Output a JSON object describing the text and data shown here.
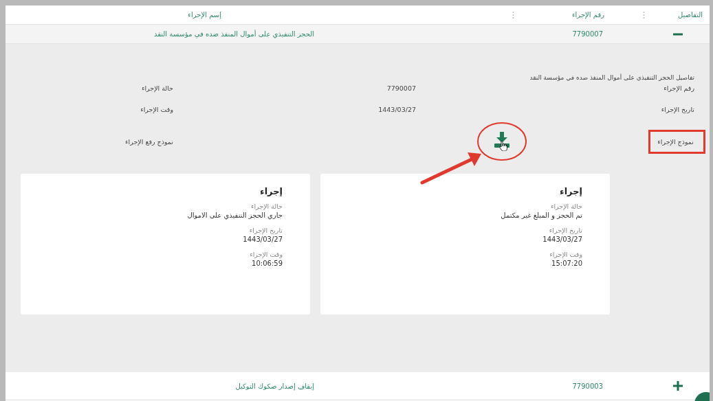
{
  "columns": [
    {
      "label": "التفاصيل"
    },
    {
      "label": "رقم الإجراء"
    },
    {
      "label": "إسم الإجراء"
    }
  ],
  "rows": [
    {
      "expanded": true,
      "number": "7790007",
      "name": "الحجز التنفيذي على أموال المنفذ ضده في مؤسسة النقد",
      "details": {
        "title": "تفاصيل الحجز التنفيذي على أموال المنفذ ضده في مؤسسة النقد",
        "rows": [
          {
            "kind": "text",
            "label": "رقم الإجراء",
            "value": "7790007",
            "side_label": "حالة الإجراء",
            "highlighted": false
          },
          {
            "kind": "text",
            "label": "تاريخ الإجراء",
            "value": "1443/03/27",
            "side_label": "وقت الإجراء",
            "highlighted": false
          },
          {
            "kind": "download",
            "label": "نموذج الإجراء",
            "side_label": "نموذج رفع الإجراء",
            "highlighted": true
          }
        ],
        "cards": [
          {
            "title": "إجراء",
            "fields": [
              {
                "label": "حالة الإجراء",
                "value": "تم الحجز و المبلغ غير مكتمل"
              },
              {
                "label": "تاريخ الإجراء",
                "value": "1443/03/27"
              },
              {
                "label": "وقت الإجراء",
                "value": "15:07:20"
              }
            ]
          },
          {
            "title": "إجراء",
            "fields": [
              {
                "label": "حالة الإجراء",
                "value": "جاري الحجز التنفيذي على الاموال"
              },
              {
                "label": "تاريخ الإجراء",
                "value": "1443/03/27"
              },
              {
                "label": "وقت الإجراء",
                "value": "10:06:59"
              }
            ]
          }
        ]
      }
    },
    {
      "expanded": false,
      "number": "7790003",
      "name": "إيقاف إصدار صكوك التوكيل"
    }
  ]
}
